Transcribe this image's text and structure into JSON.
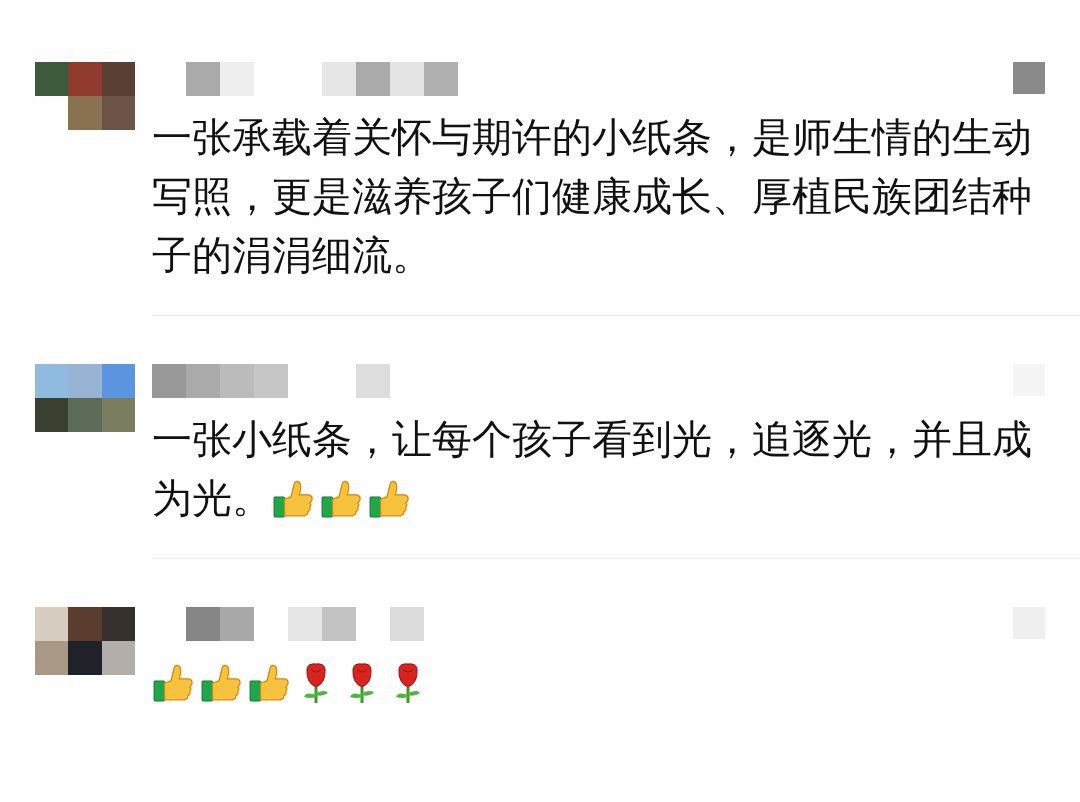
{
  "comments": [
    {
      "lines": [
        "一张承载着关怀与期许的小纸条，是师生情的生动",
        "写照，更是滋养孩子们健康成长、厚植民族团结种",
        "子的涓涓细流。"
      ]
    },
    {
      "lines": [
        "一张小纸条，让每个孩子看到光，追逐光，并且成",
        "为光。"
      ],
      "reactions": [
        {
          "kind": "thumbs_up"
        },
        {
          "kind": "thumbs_up"
        },
        {
          "kind": "thumbs_up"
        }
      ]
    },
    {
      "reactions": [
        {
          "kind": "thumbs_up"
        },
        {
          "kind": "thumbs_up"
        },
        {
          "kind": "thumbs_up"
        },
        {
          "kind": "rose"
        },
        {
          "kind": "rose"
        },
        {
          "kind": "rose"
        }
      ]
    }
  ]
}
